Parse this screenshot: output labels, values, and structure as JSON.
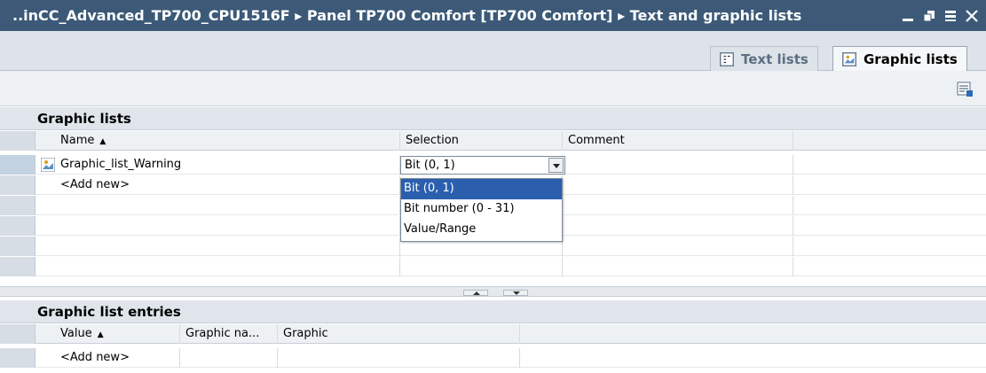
{
  "window": {
    "title": "..inCC_Advanced_TP700_CPU1516F  ▸  Panel TP700 Comfort [TP700 Comfort]  ▸  Text and graphic lists"
  },
  "tabs": [
    {
      "label": "Text lists",
      "icon": "text-list-icon",
      "active": false
    },
    {
      "label": "Graphic lists",
      "icon": "graphic-list-icon",
      "active": true
    }
  ],
  "graphic_lists": {
    "section_title": "Graphic lists",
    "columns": {
      "name": "Name",
      "selection": "Selection",
      "comment": "Comment"
    },
    "rows": [
      {
        "name": "Graphic_list_Warning",
        "selection": "Bit (0, 1)",
        "comment": ""
      },
      {
        "name": "<Add new>",
        "selection": "",
        "comment": ""
      }
    ],
    "selection_options": [
      "Bit (0, 1)",
      "Bit number (0 - 31)",
      "Value/Range"
    ],
    "selected_option": "Bit (0, 1)"
  },
  "graphic_list_entries": {
    "section_title": "Graphic list entries",
    "columns": {
      "value": "Value",
      "graphic_name": "Graphic na...",
      "graphic": "Graphic"
    },
    "rows": [
      {
        "value": "<Add new>",
        "graphic_name": "",
        "graphic": ""
      }
    ]
  },
  "colors": {
    "titlebar": "#3c5a78",
    "selection_highlight": "#2b5fae"
  }
}
